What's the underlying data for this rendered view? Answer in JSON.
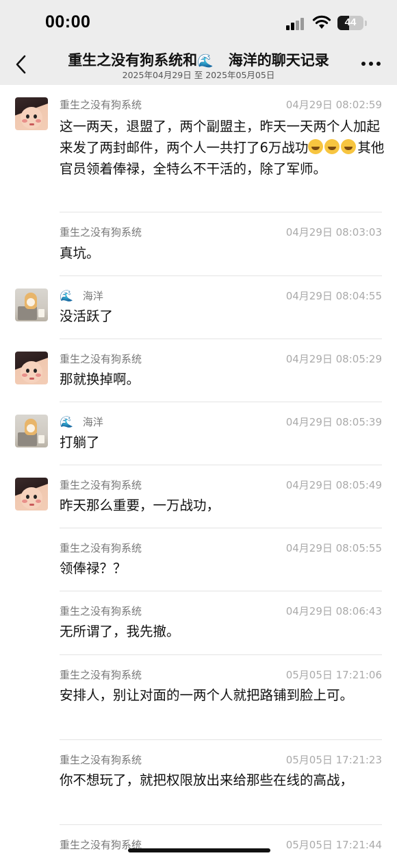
{
  "status_bar": {
    "time": "00:00",
    "battery": "44",
    "battery_fraction": 0.44
  },
  "header": {
    "title_part1": "重生之没有狗系统和",
    "title_part2": "海洋的聊天记录",
    "wave_glyph": "🌊",
    "date_range": "2025年04月29日 至 2025年05月05日"
  },
  "messages": [
    {
      "sender": "重生之没有狗系统",
      "avatar": "baby",
      "time": "04月29日 08:02:59",
      "text_before_emoji": "这一两天，退盟了，两个副盟主，昨天一天两个人加起来发了两封邮件，两个人一共打了6万战功",
      "emoji_count": 3,
      "emoji_name": "laughing-crying-emoji",
      "text_after_emoji": "其他官员领着俸禄，全特么不干活的，除了军师。"
    },
    {
      "sender": "重生之没有狗系统",
      "avatar": "none",
      "time": "04月29日 08:03:03",
      "text": "真坑。"
    },
    {
      "sender": "海洋",
      "avatar": "dog",
      "time": "04月29日 08:04:55",
      "text": "没活跃了"
    },
    {
      "sender": "重生之没有狗系统",
      "avatar": "baby",
      "time": "04月29日 08:05:29",
      "text": "那就换掉啊。"
    },
    {
      "sender": "海洋",
      "avatar": "dog",
      "time": "04月29日 08:05:39",
      "text": "打躺了"
    },
    {
      "sender": "重生之没有狗系统",
      "avatar": "baby",
      "time": "04月29日 08:05:49",
      "text": "昨天那么重要，一万战功，"
    },
    {
      "sender": "重生之没有狗系统",
      "avatar": "none",
      "time": "04月29日 08:05:55",
      "text": "领俸禄？？"
    },
    {
      "sender": "重生之没有狗系统",
      "avatar": "none",
      "time": "04月29日 08:06:43",
      "text": "无所谓了，我先撤。"
    },
    {
      "sender": "重生之没有狗系统",
      "avatar": "none",
      "time": "05月05日 17:21:06",
      "text": "安排人，别让对面的一两个人就把路铺到脸上可。"
    },
    {
      "sender": "重生之没有狗系统",
      "avatar": "none",
      "time": "05月05日 17:21:23",
      "text": "你不想玩了，就把权限放出来给那些在线的高战，"
    },
    {
      "sender": "重生之没有狗系统",
      "avatar": "none",
      "time": "05月05日 17:21:44",
      "text": ""
    }
  ]
}
